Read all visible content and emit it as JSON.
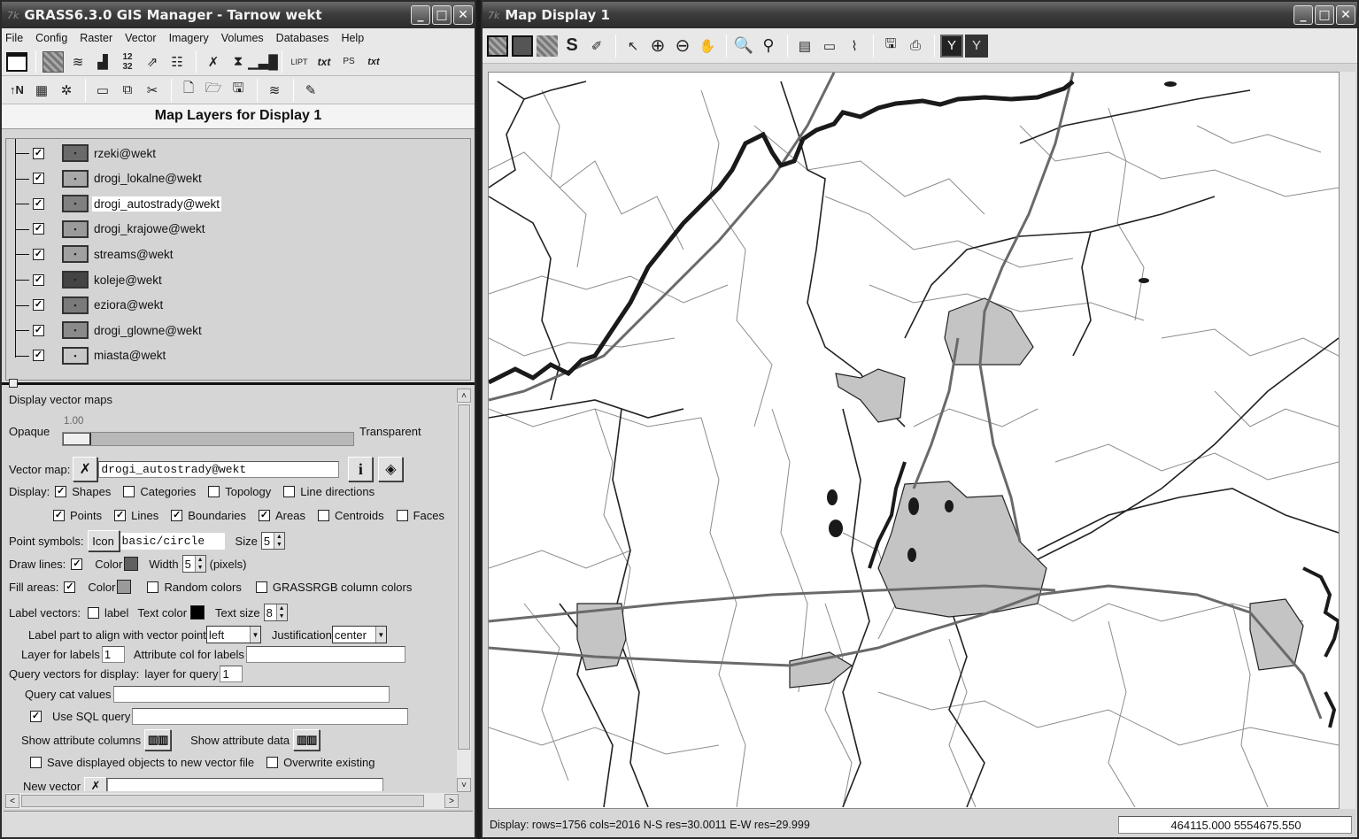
{
  "manager": {
    "title": "GRASS6.3.0 GIS Manager - Tarnow wekt",
    "menus": [
      "File",
      "Config",
      "Raster",
      "Vector",
      "Imagery",
      "Volumes",
      "Databases",
      "Help"
    ],
    "toolbar1": [
      "new-display-icon",
      "raster-map-icon",
      "rgb-layers-icon",
      "histogram-icon",
      "legend-icon",
      "arrows-icon",
      "thematic-icon",
      "vector-map-icon",
      "shaded-relief-icon",
      "chart-icon",
      "label-icon",
      "text-icon",
      "ps-label-icon",
      "ps-text-icon"
    ],
    "toolbar2": [
      "north-arrow-icon",
      "grid-icon",
      "gear-icon",
      "folder-icon",
      "copy-icon",
      "cut-icon",
      "new-file-icon",
      "open-file-icon",
      "save-icon",
      "layers-icon",
      "digitize-icon"
    ],
    "layers_header": "Map Layers for Display 1",
    "layers": [
      {
        "name": "rzeki@wekt",
        "checked": true,
        "swatch": "#6a6a6a",
        "selected": false
      },
      {
        "name": "drogi_lokalne@wekt",
        "checked": true,
        "swatch": "#a8a8a8",
        "selected": false
      },
      {
        "name": "drogi_autostrady@wekt",
        "checked": true,
        "swatch": "#808080",
        "selected": true
      },
      {
        "name": "drogi_krajowe@wekt",
        "checked": true,
        "swatch": "#9a9a9a",
        "selected": false
      },
      {
        "name": "streams@wekt",
        "checked": true,
        "swatch": "#a0a0a0",
        "selected": false
      },
      {
        "name": "koleje@wekt",
        "checked": true,
        "swatch": "#444444",
        "selected": false
      },
      {
        "name": "eziora@wekt",
        "checked": true,
        "swatch": "#7a7a7a",
        "selected": false
      },
      {
        "name": "drogi_glowne@wekt",
        "checked": true,
        "swatch": "#8a8a8a",
        "selected": false
      },
      {
        "name": "miasta@wekt",
        "checked": true,
        "swatch": "#c8c8c8",
        "selected": false
      }
    ],
    "options": {
      "section_title": "Display vector maps",
      "opacity_value": "1.00",
      "opaque_label": "Opaque",
      "transparent_label": "Transparent",
      "vector_map_label": "Vector map:",
      "vector_map_value": "drogi_autostrady@wekt",
      "display_label": "Display:",
      "display_opts": [
        {
          "label": "Shapes",
          "checked": true
        },
        {
          "label": "Categories",
          "checked": false
        },
        {
          "label": "Topology",
          "checked": false
        },
        {
          "label": "Line directions",
          "checked": false
        }
      ],
      "feature_opts": [
        {
          "label": "Points",
          "checked": true
        },
        {
          "label": "Lines",
          "checked": true
        },
        {
          "label": "Boundaries",
          "checked": true
        },
        {
          "label": "Areas",
          "checked": true
        },
        {
          "label": "Centroids",
          "checked": false
        },
        {
          "label": "Faces",
          "checked": false
        }
      ],
      "point_symbols_label": "Point symbols:",
      "icon_button": "Icon",
      "symbol_value": "basic/circle",
      "size_label": "Size",
      "size_value": "5",
      "draw_lines_label": "Draw lines:",
      "draw_lines_checked": true,
      "color_label": "Color",
      "line_color": "#606060",
      "width_label": "Width",
      "width_value": "5",
      "pixels_label": "(pixels)",
      "fill_areas_label": "Fill areas:",
      "fill_areas_checked": true,
      "fill_color": "#9a9a9a",
      "random_colors_label": "Random colors",
      "grassrgb_label": "GRASSRGB column colors",
      "label_vectors_label": "Label vectors:",
      "label_label": "label",
      "text_color_label": "Text color",
      "text_color": "#000000",
      "text_size_label": "Text size",
      "text_size_value": "8",
      "label_align_label": "Label part to align with vector point",
      "label_align_value": "left",
      "justification_label": "Justification",
      "justification_value": "center",
      "layer_labels_label": "Layer for labels",
      "layer_labels_value": "1",
      "attr_col_label": "Attribute col for labels",
      "attr_col_value": "",
      "query_vectors_label": "Query vectors for display:",
      "layer_query_label": "layer for query",
      "layer_query_value": "1",
      "query_cat_label": "Query cat values",
      "query_cat_value": "",
      "use_sql_label": "Use SQL query",
      "use_sql_checked": true,
      "sql_value": "",
      "show_attr_cols_label": "Show attribute columns",
      "show_attr_data_label": "Show attribute data",
      "save_new_label": "Save displayed objects to new vector file",
      "overwrite_label": "Overwrite existing",
      "new_vector_label": "New vector",
      "new_vector_value": ""
    }
  },
  "display": {
    "title": "Map Display 1",
    "toolbar": [
      "display-all-icon",
      "redraw-icon",
      "zoom-to-region-icon",
      "rerender-icon",
      "erase-icon",
      "pointer-icon",
      "zoom-in-icon",
      "zoom-out-icon",
      "pan-icon",
      "zoom-back-icon",
      "zoom-menu-icon",
      "query-icon",
      "measure-icon",
      "profile-icon",
      "export-icon",
      "print-icon",
      "explore-mode-icon",
      "constrain-mode-icon"
    ],
    "status_text": "Display: rows=1756 cols=2016  N-S res=30.0011  E-W res=29.999",
    "coords": "464115.000 5554675.550",
    "colors": {
      "river": "#1a1a1a",
      "local_road": "#8c8c8c",
      "highway": "#6a6a6a",
      "main_road": "#222222",
      "city_fill": "#c4c4c4"
    }
  }
}
